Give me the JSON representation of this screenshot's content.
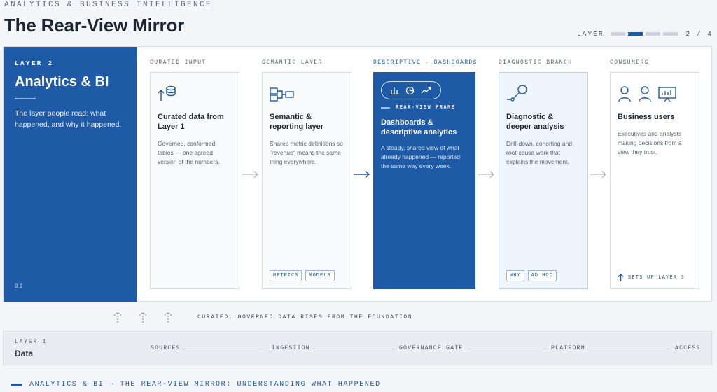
{
  "header": {
    "eyebrow": "ANALYTICS & BUSINESS INTELLIGENCE",
    "title": "The Rear-View Mirror",
    "progress": {
      "label": "LAYER",
      "current": 2,
      "total": 4,
      "count_text": "2 / 4"
    }
  },
  "layer_panel": {
    "tag": "LAYER 2",
    "title": "Analytics & BI",
    "description": "The layer people read: what happened, and why it happened.",
    "footer": "BI"
  },
  "columns": [
    {
      "heading": "CURATED INPUT",
      "icon": "database-upload-icon",
      "title": "Curated data from Layer 1",
      "description": "Governed, conformed tables — one agreed version of the numbers."
    },
    {
      "heading": "SEMANTIC LAYER",
      "icon": "model-link-icon",
      "title": "Semantic & reporting layer",
      "description": "Shared metric definitions so \"revenue\" means the same thing everywhere.",
      "chips": [
        "METRICS",
        "MODELS"
      ]
    },
    {
      "heading": "DESCRIPTIVE · DASHBOARDS",
      "icons": [
        "bar-chart-icon",
        "pie-chart-icon",
        "trend-line-icon"
      ],
      "frame_label": "REAR-VIEW FRAME",
      "title": "Dashboards & descriptive analytics",
      "description": "A steady, shared view of what already happened — reported the same way every week."
    },
    {
      "heading": "DIAGNOSTIC BRANCH",
      "icon": "drill-search-icon",
      "title": "Diagnostic & deeper analysis",
      "description": "Drill-down, cohorting and root-cause work that explains the movement.",
      "chips": [
        "WHY",
        "AD HOC"
      ]
    },
    {
      "heading": "CONSUMERS",
      "icons": [
        "user-icon",
        "user-icon",
        "presentation-icon"
      ],
      "title": "Business users",
      "description": "Executives and analysts making decisions from a view they trust.",
      "footer": "SETS UP LAYER 3"
    }
  ],
  "rise_text": "CURATED, GOVERNED DATA RISES FROM THE FOUNDATION",
  "foundation": {
    "tag": "LAYER 1",
    "title": "Data",
    "steps": [
      "SOURCES",
      "INGESTION",
      "GOVERNANCE GATE",
      "PLATFORM",
      "ACCESS"
    ]
  },
  "caption": "ANALYTICS & BI — THE REAR-VIEW MIRROR: UNDERSTANDING WHAT HAPPENED",
  "colors": {
    "primary": "#1f5aa6",
    "background": "#f3f5f8",
    "diagnostic_bg": "#eef5fc"
  }
}
